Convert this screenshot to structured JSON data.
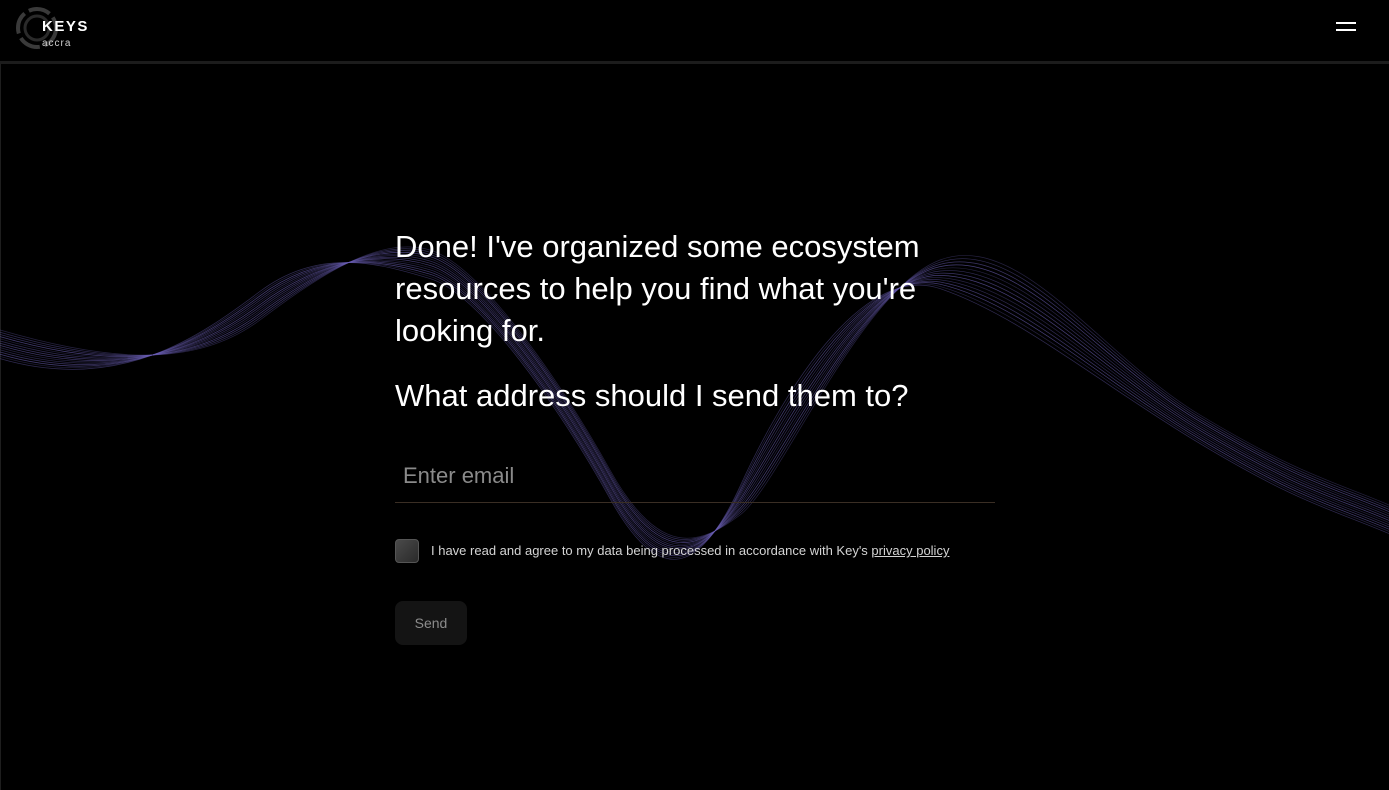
{
  "header": {
    "logo_title": "KEYS",
    "logo_subtitle": "accra",
    "menu_icon": "hamburger-menu-icon"
  },
  "main": {
    "intro": "Done! I've organized some ecosystem resources to help you find what you're looking for.",
    "question": "What address should I send them to?",
    "email_placeholder": "Enter email",
    "email_value": "",
    "consent_prefix": "I have read and agree to my data being processed in accordance with Key's ",
    "consent_link": "privacy policy",
    "consent_checked": false,
    "send_label": "Send"
  },
  "colors": {
    "background": "#000000",
    "text": "#ffffff",
    "wave": "#6b5fb5",
    "input_underline": "#3a2e24",
    "button_bg": "#141414",
    "button_text": "#8c8c8c"
  }
}
